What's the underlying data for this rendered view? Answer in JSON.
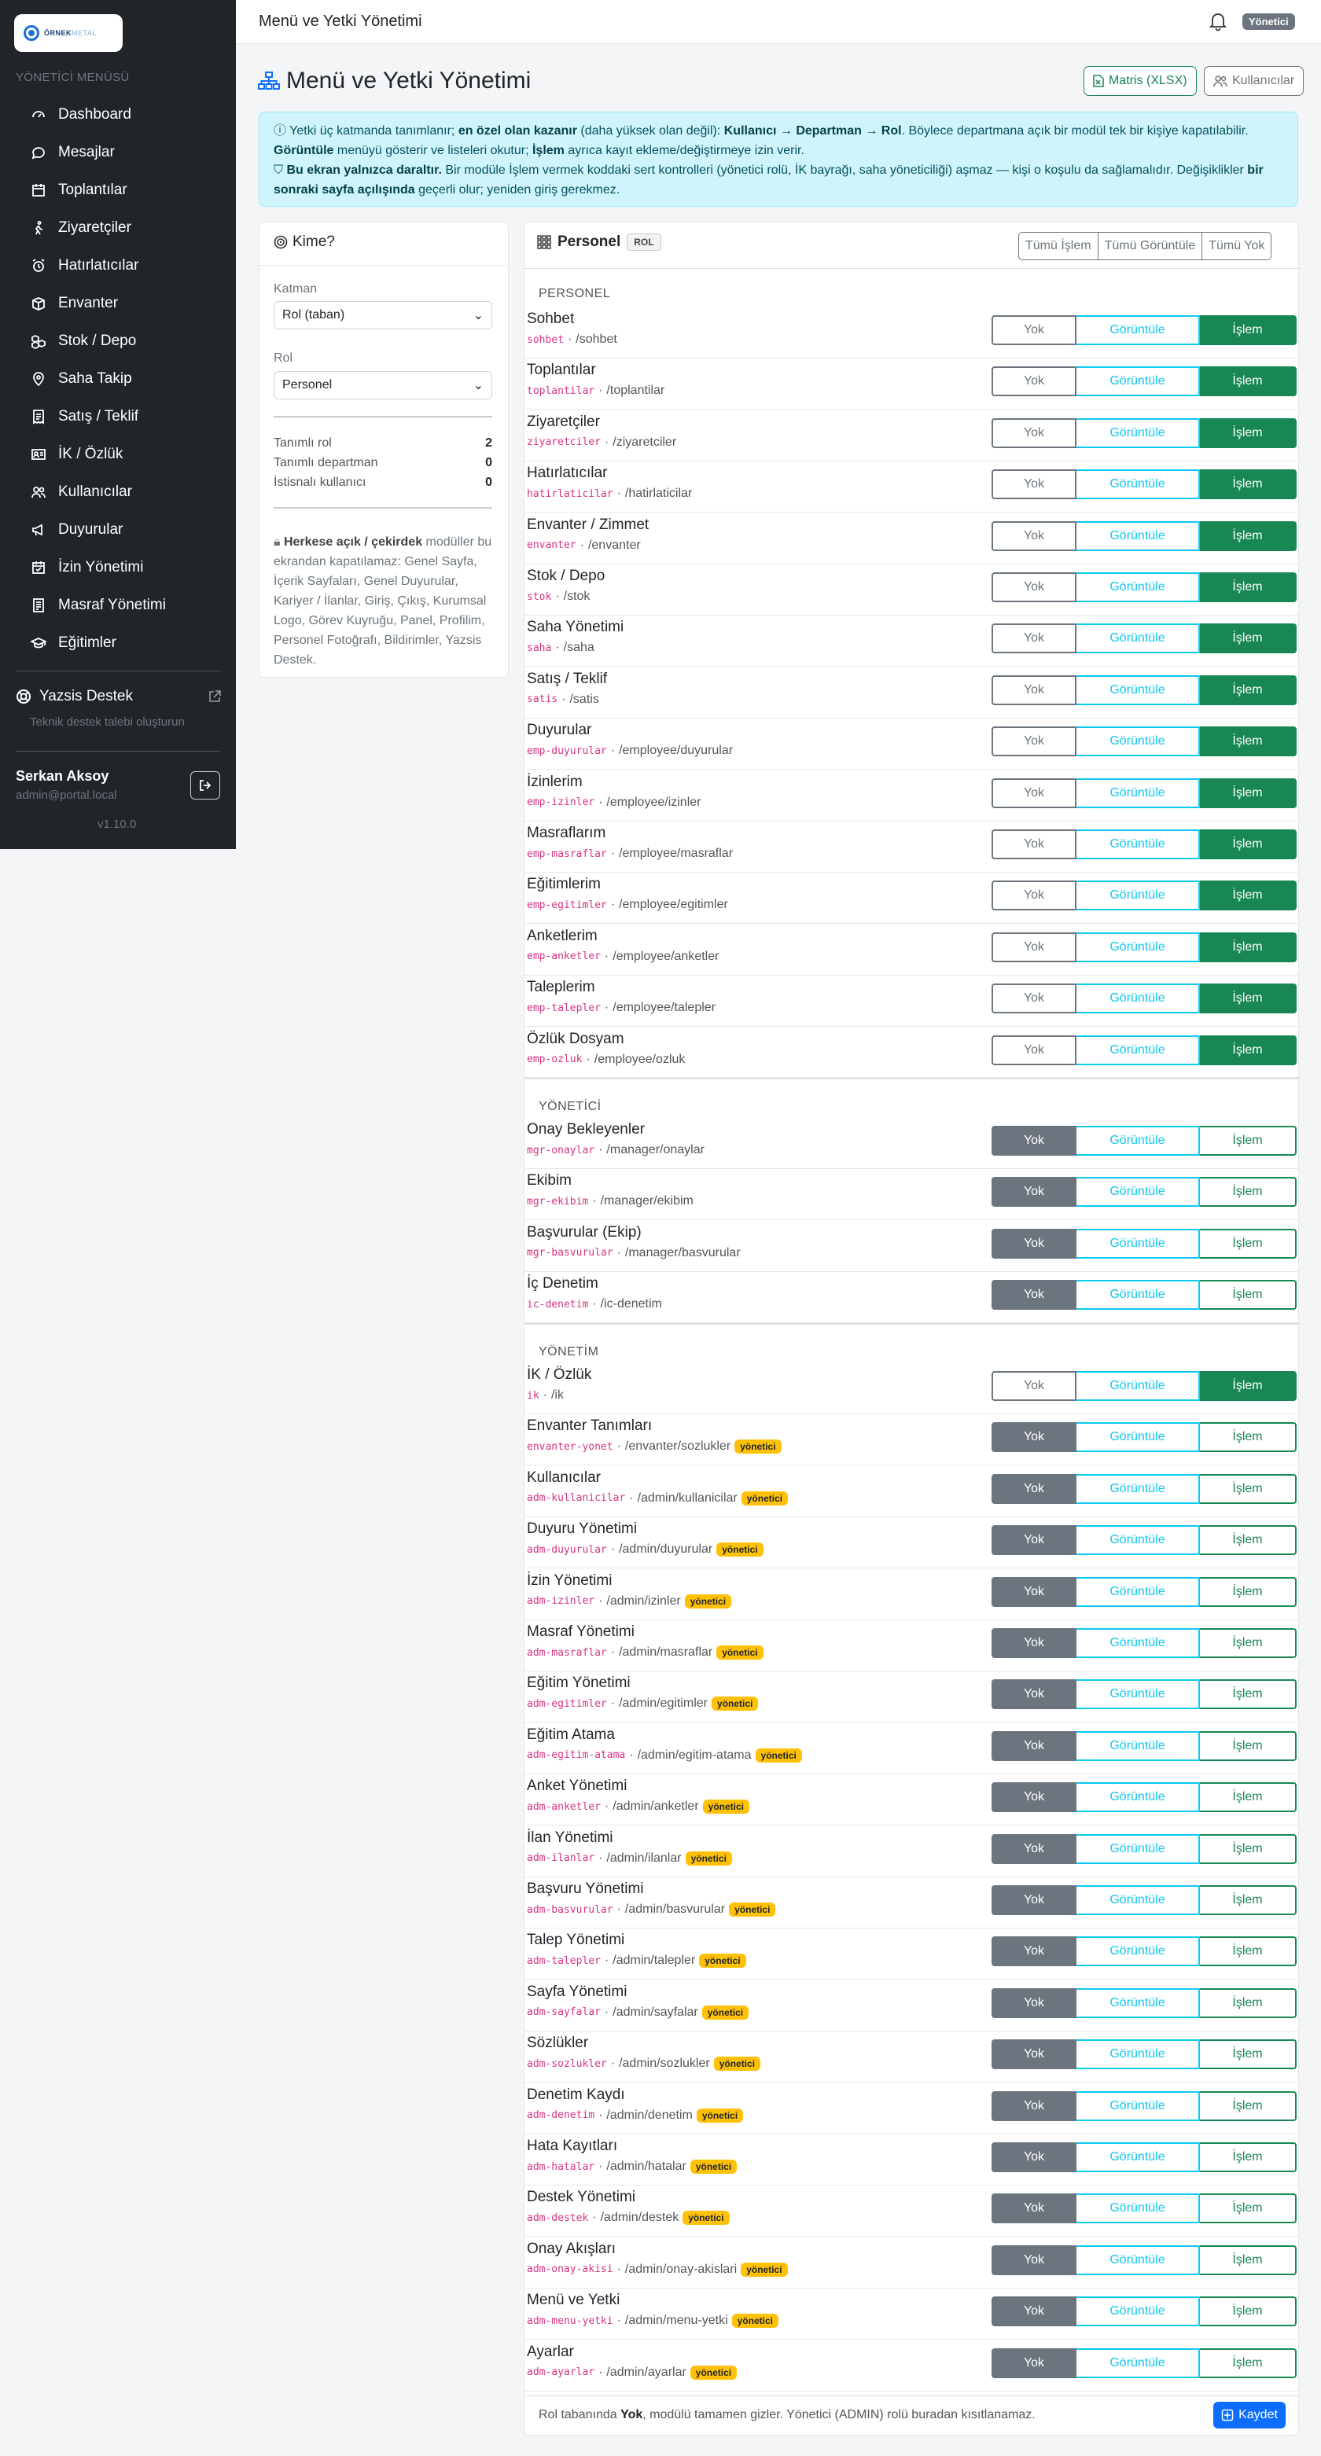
{
  "sidebar": {
    "logo": {
      "text": "ÖRNEK",
      "sub": "METAL"
    },
    "heading": "YÖNETİCİ MENÜSÜ",
    "items": [
      {
        "label": "Dashboard",
        "icon": "dashboard-icon"
      },
      {
        "label": "Mesajlar",
        "icon": "chat-icon"
      },
      {
        "label": "Toplantılar",
        "icon": "calendar-icon"
      },
      {
        "label": "Ziyaretçiler",
        "icon": "walking-person-icon"
      },
      {
        "label": "Hatırlatıcılar",
        "icon": "alarm-icon"
      },
      {
        "label": "Envanter",
        "icon": "box-icon"
      },
      {
        "label": "Stok / Depo",
        "icon": "boxes-icon"
      },
      {
        "label": "Saha Takip",
        "icon": "map-pin-icon"
      },
      {
        "label": "Satış / Teklif",
        "icon": "receipt-icon"
      },
      {
        "label": "İK / Özlük",
        "icon": "id-card-icon"
      },
      {
        "label": "Kullanıcılar",
        "icon": "people-icon"
      },
      {
        "label": "Duyurular",
        "icon": "megaphone-icon"
      },
      {
        "label": "İzin Yönetimi",
        "icon": "calendar-check-icon"
      },
      {
        "label": "Masraf Yönetimi",
        "icon": "receipt-list-icon"
      },
      {
        "label": "Eğitimler",
        "icon": "mortarboard-icon"
      }
    ],
    "support": {
      "label": "Yazsis Destek",
      "sub": "Teknik destek talebi oluşturun"
    },
    "user": {
      "name": "Serkan Aksoy",
      "email": "admin@portal.local"
    },
    "version": "v1.10.0"
  },
  "topbar": {
    "title": "Menü ve Yetki Yönetimi",
    "role_badge": "Yönetici"
  },
  "page": {
    "title": "Menü ve Yetki Yönetimi",
    "btn_matrix": "Matris (XLSX)",
    "btn_users": "Kullanıcılar",
    "alert": {
      "l1_a": "Yetki üç katmanda tanımlanır; ",
      "l1_b": "en özel olan kazanır",
      "l1_c": " (daha yüksek olan değil): ",
      "l1_d": "Kullanıcı → Departman → Rol",
      "l1_e": ". Böylece departmana açık bir modül tek bir kişiye kapatılabilir. ",
      "l1_f": "Görüntüle",
      "l1_g": " menüyü gösterir ve listeleri okutur; ",
      "l1_h": "İşlem",
      "l1_i": " ayrıca kayıt ekleme/değiştirmeye izin verir.",
      "l2_a": "Bu ekran yalnızca daraltır.",
      "l2_b": " Bir modüle İşlem vermek koddaki sert kontrolleri (yönetici rolü, İK bayrağı, saha yöneticiliği) aşmaz — kişi o koşulu da sağlamalıdır. Değişiklikler ",
      "l2_c": "bir sonraki sayfa açılışında",
      "l2_d": " geçerli olur; yeniden giriş gerekmez."
    }
  },
  "kime": {
    "title": "Kime?",
    "katman_label": "Katman",
    "katman_value": "Rol (taban)",
    "rol_label": "Rol",
    "rol_value": "Personel",
    "stats": [
      {
        "label": "Tanımlı rol",
        "value": "2"
      },
      {
        "label": "Tanımlı departman",
        "value": "0"
      },
      {
        "label": "İstisnalı kullanıcı",
        "value": "0"
      }
    ],
    "note_title": "Herkese açık / çekirdek",
    "note_text": " modüller bu ekrandan kapatılamaz: Genel Sayfa, İçerik Sayfaları, Genel Duyurular, Kariyer / İlanlar, Giriş, Çıkış, Kurumsal Logo, Görev Kuyruğu, Panel, Profilim, Personel Fotoğrafı, Bildirimler, Yazsis Destek."
  },
  "matrix": {
    "title": "Personel",
    "badge": "ROL",
    "bulk": [
      "Tümü İşlem",
      "Tümü Görüntüle",
      "Tümü Yok"
    ],
    "states": [
      "Yok",
      "Görüntüle",
      "İşlem"
    ],
    "admin_badge": "yönetici",
    "sections": [
      {
        "name": "PERSONEL",
        "rows": [
          {
            "label": "Sohbet",
            "code": "sohbet",
            "path": "/sohbet",
            "state": 2,
            "admin": false
          },
          {
            "label": "Toplantılar",
            "code": "toplantilar",
            "path": "/toplantilar",
            "state": 2,
            "admin": false
          },
          {
            "label": "Ziyaretçiler",
            "code": "ziyaretciler",
            "path": "/ziyaretciler",
            "state": 2,
            "admin": false
          },
          {
            "label": "Hatırlatıcılar",
            "code": "hatirlaticilar",
            "path": "/hatirlaticilar",
            "state": 2,
            "admin": false
          },
          {
            "label": "Envanter / Zimmet",
            "code": "envanter",
            "path": "/envanter",
            "state": 2,
            "admin": false
          },
          {
            "label": "Stok / Depo",
            "code": "stok",
            "path": "/stok",
            "state": 2,
            "admin": false
          },
          {
            "label": "Saha Yönetimi",
            "code": "saha",
            "path": "/saha",
            "state": 2,
            "admin": false
          },
          {
            "label": "Satış / Teklif",
            "code": "satis",
            "path": "/satis",
            "state": 2,
            "admin": false
          },
          {
            "label": "Duyurular",
            "code": "emp-duyurular",
            "path": "/employee/duyurular",
            "state": 2,
            "admin": false
          },
          {
            "label": "İzinlerim",
            "code": "emp-izinler",
            "path": "/employee/izinler",
            "state": 2,
            "admin": false
          },
          {
            "label": "Masraflarım",
            "code": "emp-masraflar",
            "path": "/employee/masraflar",
            "state": 2,
            "admin": false
          },
          {
            "label": "Eğitimlerim",
            "code": "emp-egitimler",
            "path": "/employee/egitimler",
            "state": 2,
            "admin": false
          },
          {
            "label": "Anketlerim",
            "code": "emp-anketler",
            "path": "/employee/anketler",
            "state": 2,
            "admin": false
          },
          {
            "label": "Taleplerim",
            "code": "emp-talepler",
            "path": "/employee/talepler",
            "state": 2,
            "admin": false
          },
          {
            "label": "Özlük Dosyam",
            "code": "emp-ozluk",
            "path": "/employee/ozluk",
            "state": 2,
            "admin": false
          }
        ]
      },
      {
        "name": "YÖNETİCİ",
        "rows": [
          {
            "label": "Onay Bekleyenler",
            "code": "mgr-onaylar",
            "path": "/manager/onaylar",
            "state": 0,
            "admin": false
          },
          {
            "label": "Ekibim",
            "code": "mgr-ekibim",
            "path": "/manager/ekibim",
            "state": 0,
            "admin": false
          },
          {
            "label": "Başvurular (Ekip)",
            "code": "mgr-basvurular",
            "path": "/manager/basvurular",
            "state": 0,
            "admin": false
          },
          {
            "label": "İç Denetim",
            "code": "ic-denetim",
            "path": "/ic-denetim",
            "state": 0,
            "admin": false
          }
        ]
      },
      {
        "name": "YÖNETİM",
        "rows": [
          {
            "label": "İK / Özlük",
            "code": "ik",
            "path": "/ik",
            "state": 2,
            "admin": false
          },
          {
            "label": "Envanter Tanımları",
            "code": "envanter-yonet",
            "path": "/envanter/sozlukler",
            "state": 0,
            "admin": true
          },
          {
            "label": "Kullanıcılar",
            "code": "adm-kullanicilar",
            "path": "/admin/kullanicilar",
            "state": 0,
            "admin": true
          },
          {
            "label": "Duyuru Yönetimi",
            "code": "adm-duyurular",
            "path": "/admin/duyurular",
            "state": 0,
            "admin": true
          },
          {
            "label": "İzin Yönetimi",
            "code": "adm-izinler",
            "path": "/admin/izinler",
            "state": 0,
            "admin": true
          },
          {
            "label": "Masraf Yönetimi",
            "code": "adm-masraflar",
            "path": "/admin/masraflar",
            "state": 0,
            "admin": true
          },
          {
            "label": "Eğitim Yönetimi",
            "code": "adm-egitimler",
            "path": "/admin/egitimler",
            "state": 0,
            "admin": true
          },
          {
            "label": "Eğitim Atama",
            "code": "adm-egitim-atama",
            "path": "/admin/egitim-atama",
            "state": 0,
            "admin": true
          },
          {
            "label": "Anket Yönetimi",
            "code": "adm-anketler",
            "path": "/admin/anketler",
            "state": 0,
            "admin": true
          },
          {
            "label": "İlan Yönetimi",
            "code": "adm-ilanlar",
            "path": "/admin/ilanlar",
            "state": 0,
            "admin": true
          },
          {
            "label": "Başvuru Yönetimi",
            "code": "adm-basvurular",
            "path": "/admin/basvurular",
            "state": 0,
            "admin": true
          },
          {
            "label": "Talep Yönetimi",
            "code": "adm-talepler",
            "path": "/admin/talepler",
            "state": 0,
            "admin": true
          },
          {
            "label": "Sayfa Yönetimi",
            "code": "adm-sayfalar",
            "path": "/admin/sayfalar",
            "state": 0,
            "admin": true
          },
          {
            "label": "Sözlükler",
            "code": "adm-sozlukler",
            "path": "/admin/sozlukler",
            "state": 0,
            "admin": true
          },
          {
            "label": "Denetim Kaydı",
            "code": "adm-denetim",
            "path": "/admin/denetim",
            "state": 0,
            "admin": true
          },
          {
            "label": "Hata Kayıtları",
            "code": "adm-hatalar",
            "path": "/admin/hatalar",
            "state": 0,
            "admin": true
          },
          {
            "label": "Destek Yönetimi",
            "code": "adm-destek",
            "path": "/admin/destek",
            "state": 0,
            "admin": true
          },
          {
            "label": "Onay Akışları",
            "code": "adm-onay-akisi",
            "path": "/admin/onay-akislari",
            "state": 0,
            "admin": true
          },
          {
            "label": "Menü ve Yetki",
            "code": "adm-menu-yetki",
            "path": "/admin/menu-yetki",
            "state": 0,
            "admin": true
          },
          {
            "label": "Ayarlar",
            "code": "adm-ayarlar",
            "path": "/admin/ayarlar",
            "state": 0,
            "admin": true
          }
        ]
      }
    ],
    "footer": {
      "a": "Rol tabanında ",
      "b": "Yok",
      "c": ", modülü tamamen gizler. Yönetici (ADMIN) rolü buradan kısıtlanamaz."
    },
    "save_label": "Kaydet"
  }
}
